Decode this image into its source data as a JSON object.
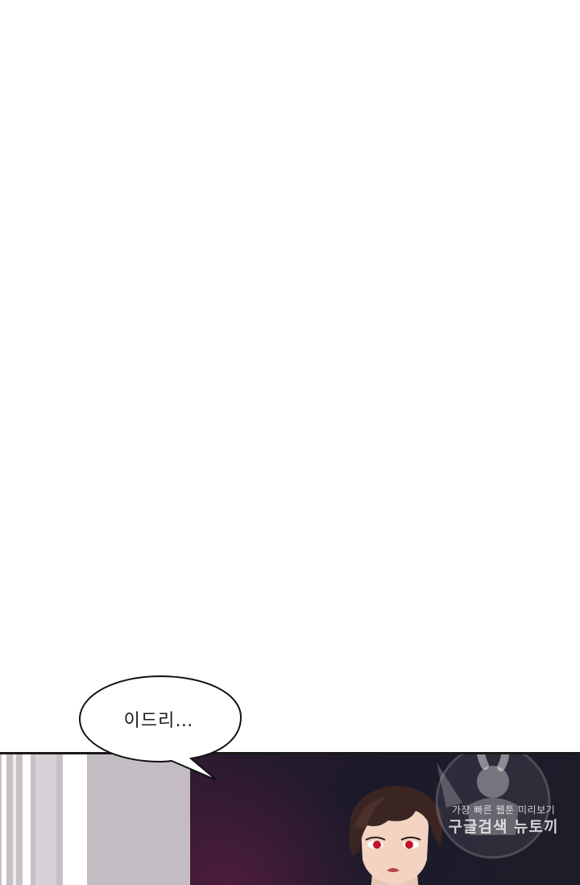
{
  "speech_bubble": {
    "text": "이드리…"
  },
  "watermark": {
    "line1": "가장 빠른 웹툰 미리보기",
    "line2": "구글검색 뉴토끼"
  },
  "colors": {
    "panel_dark": "#1d1d29",
    "panel_left": "#c8c0c6",
    "bubble_fill": "#ffffff",
    "bubble_outline": "#111111",
    "eye_red": "#c0142a"
  }
}
